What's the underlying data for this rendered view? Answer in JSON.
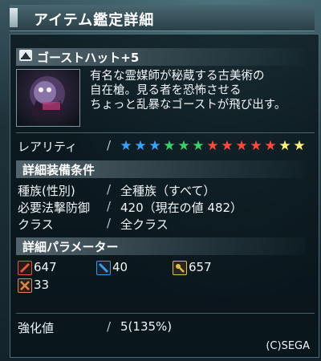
{
  "window": {
    "title": "アイテム鑑定詳細"
  },
  "item": {
    "name": "ゴーストハット+5",
    "description": [
      "有名な霊媒師が秘蔵する古美術の",
      "自在槍。見る者を恐怖させる",
      "ちょっと乱暴なゴーストが飛び出す。"
    ]
  },
  "rarity": {
    "label": "レアリティ",
    "count": 13,
    "star_colors": [
      "#3aa0ff",
      "#3aa0ff",
      "#3aa0ff",
      "#3ad06a",
      "#3ad06a",
      "#3ad06a",
      "#ff4a3a",
      "#ff4a3a",
      "#ff4a3a",
      "#ff4a3a",
      "#ff4a3a",
      "#fff07a",
      "#fff07a"
    ]
  },
  "equip": {
    "header": "詳細装備条件",
    "rows": [
      {
        "label": "種族(性別)",
        "value": "全種族（すべて）"
      },
      {
        "label": "必要法撃防御",
        "value": "420（現在の値 482）"
      },
      {
        "label": "クラス",
        "value": "全クラス"
      }
    ]
  },
  "params": {
    "header": "詳細パラメーター",
    "items": [
      {
        "icon": "striking-defense-icon",
        "color": "#e05a3a",
        "value": "647"
      },
      {
        "icon": "ranged-defense-icon",
        "color": "#3a9ce0",
        "value": "40"
      },
      {
        "icon": "technique-defense-icon",
        "color": "#e0c040",
        "value": "657"
      },
      {
        "icon": "element-resistance-icon",
        "color": "#d88850",
        "value": "33"
      }
    ]
  },
  "enhance": {
    "label": "強化値",
    "value": "5(135%)"
  },
  "copyright": "(C)SEGA",
  "colors": {
    "accent": "#6d8c96",
    "panel": "#06101a"
  }
}
